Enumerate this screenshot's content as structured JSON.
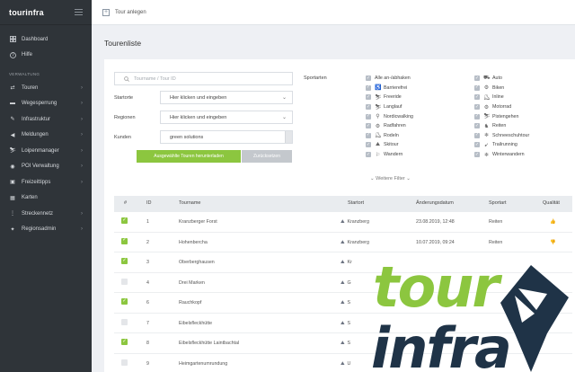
{
  "app": {
    "name": "tourinfra"
  },
  "sidebar": {
    "items_top": [
      {
        "label": "Dashboard",
        "icon": "dashboard-icon"
      },
      {
        "label": "Hilfe",
        "icon": "help-icon"
      }
    ],
    "section": "VERWALTUNG",
    "items": [
      {
        "label": "Touren",
        "icon": "route-icon",
        "has_chevron": true
      },
      {
        "label": "Wegesperrung",
        "icon": "barrier-icon",
        "has_chevron": true
      },
      {
        "label": "Infrastruktur",
        "icon": "tools-icon",
        "has_chevron": true
      },
      {
        "label": "Meldungen",
        "icon": "megaphone-icon",
        "has_chevron": true
      },
      {
        "label": "Loipenmanager",
        "icon": "skier-icon",
        "has_chevron": true
      },
      {
        "label": "POI Verwaltung",
        "icon": "poi-icon",
        "has_chevron": true
      },
      {
        "label": "Freizeittipps",
        "icon": "tips-icon",
        "has_chevron": true
      },
      {
        "label": "Karten",
        "icon": "map-icon",
        "has_chevron": false
      },
      {
        "label": "Streckennetz",
        "icon": "network-icon",
        "has_chevron": true
      },
      {
        "label": "Regionsadmin",
        "icon": "admin-icon",
        "has_chevron": true
      }
    ]
  },
  "topbar": {
    "new_tour": "Tour anlegen"
  },
  "page": {
    "title": "Tourenliste"
  },
  "filters": {
    "search_placeholder": "Tourname / Tour ID",
    "startorte_label": "Startorte",
    "startorte_placeholder": "Hier klicken und eingeben",
    "regionen_label": "Regionen",
    "regionen_placeholder": "Hier klicken und eingeben",
    "kunden_label": "Kunden",
    "kunden_value": "green solutions",
    "download_button": "Ausgewählte Touren herunterladen",
    "reset_button": "Zurücksetzen",
    "sportarten_label": "Sportarten",
    "more_filters": "Weitere Filter"
  },
  "sportarten_col1": [
    {
      "label": "Alle an-/abhaken",
      "icon": ""
    },
    {
      "label": "Barrierefrei",
      "icon": "wheelchair-icon"
    },
    {
      "label": "Freeride",
      "icon": "freeride-icon"
    },
    {
      "label": "Langlauf",
      "icon": "crosscountry-icon"
    },
    {
      "label": "Nordicwalking",
      "icon": "nordicwalking-icon"
    },
    {
      "label": "Radfahren",
      "icon": "bike-icon"
    },
    {
      "label": "Rodeln",
      "icon": "sled-icon"
    },
    {
      "label": "Skitour",
      "icon": "skitour-icon"
    },
    {
      "label": "Wandern",
      "icon": "hiking-icon"
    }
  ],
  "sportarten_col2": [
    {
      "label": "Auto",
      "icon": "car-icon"
    },
    {
      "label": "Biken",
      "icon": "mtb-icon"
    },
    {
      "label": "Inline",
      "icon": "inline-icon"
    },
    {
      "label": "Motorrad",
      "icon": "motorcycle-icon"
    },
    {
      "label": "Pistengehen",
      "icon": "piste-icon"
    },
    {
      "label": "Reiten",
      "icon": "horse-icon"
    },
    {
      "label": "Schneeschuhtour",
      "icon": "snowshoe-icon"
    },
    {
      "label": "Trailrunning",
      "icon": "trailrun-icon"
    },
    {
      "label": "Winterwandern",
      "icon": "winterhike-icon"
    }
  ],
  "table": {
    "headers": [
      "#",
      "ID",
      "Tourname",
      "Startort",
      "Änderungsdatum",
      "Sportart",
      "Qualität"
    ],
    "rows": [
      {
        "checked": true,
        "id": "1",
        "name": "Kranzberger Forst",
        "startort": "Kranzberg",
        "date": "23.08.2019, 12:48",
        "sport": "Reiten",
        "quality": "thumbs-up-icon"
      },
      {
        "checked": true,
        "id": "2",
        "name": "Hohenbercha",
        "startort": "Kranzberg",
        "date": "10.07.2019, 09:24",
        "sport": "Reiten",
        "quality": "thumbs-down-icon"
      },
      {
        "checked": true,
        "id": "3",
        "name": "Oberberghausen",
        "startort": "Kr",
        "date": "",
        "sport": "",
        "quality": ""
      },
      {
        "checked": false,
        "id": "4",
        "name": "Drei Marken",
        "startort": "G",
        "date": "",
        "sport": "",
        "quality": ""
      },
      {
        "checked": true,
        "id": "6",
        "name": "Rauchkopf",
        "startort": "S",
        "date": "",
        "sport": "",
        "quality": ""
      },
      {
        "checked": false,
        "id": "7",
        "name": "Eibelsfleckhütte",
        "startort": "S",
        "date": "",
        "sport": "",
        "quality": ""
      },
      {
        "checked": true,
        "id": "8",
        "name": "Eibelsfleckhütte Laintbachtal",
        "startort": "S",
        "date": "",
        "sport": "",
        "quality": ""
      },
      {
        "checked": false,
        "id": "9",
        "name": "Heimgartenumrundung",
        "startort": "U",
        "date": "",
        "sport": "",
        "quality": ""
      }
    ]
  },
  "overlay_logo": {
    "line1": "tour",
    "line2": "infra",
    "colors": {
      "green": "#8cc63f",
      "navy": "#1f3347"
    }
  },
  "colors": {
    "sidebar_bg": "#2f3439",
    "accent_green": "#8cc63f",
    "page_bg": "#eef0f4"
  }
}
